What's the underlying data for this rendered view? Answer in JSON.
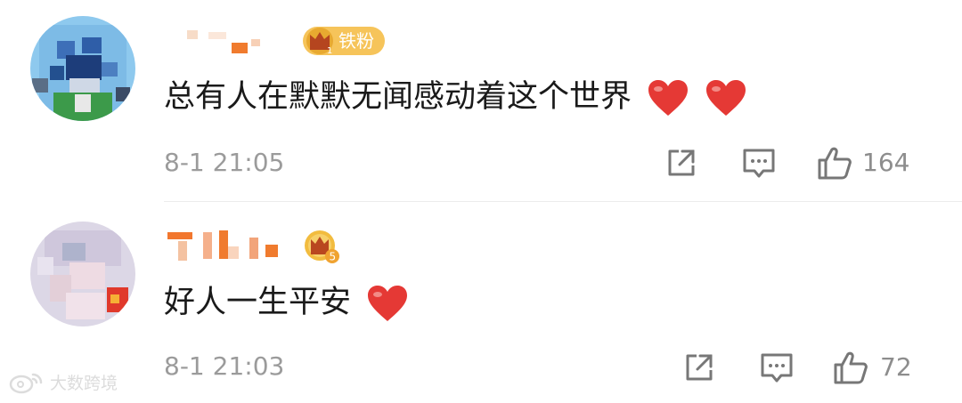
{
  "comments": [
    {
      "badge_label": "铁粉",
      "text": "总有人在默默无闻感动着这个世界",
      "heart_count_in_text": 2,
      "time": "8-1 21:05",
      "likes": "164"
    },
    {
      "badge_label": "5",
      "text": "好人一生平安",
      "heart_count_in_text": 1,
      "time": "8-1 21:03",
      "likes": "72"
    }
  ],
  "watermark": {
    "text": "大数跨境"
  },
  "icons": [
    "repost-icon",
    "comment-icon",
    "like-icon",
    "heart-emoji-icon",
    "crown-badge-icon"
  ],
  "colors": {
    "badge": "#f6c45a",
    "heart": "#e53935",
    "meta": "#9b9b9b"
  }
}
